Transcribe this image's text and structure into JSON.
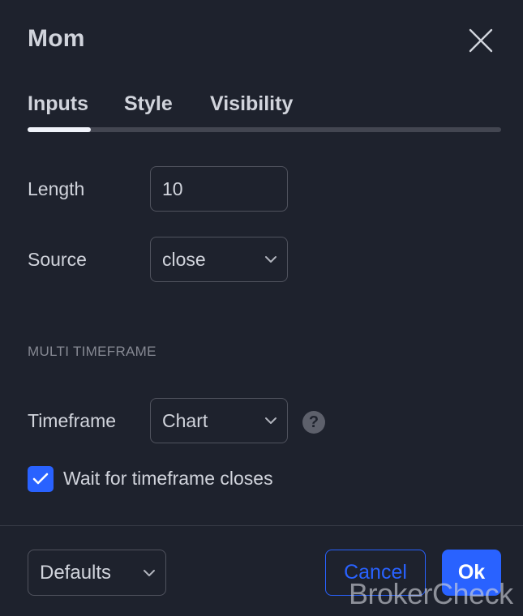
{
  "dialog": {
    "title": "Mom"
  },
  "tabs": [
    {
      "label": "Inputs",
      "active": true
    },
    {
      "label": "Style",
      "active": false
    },
    {
      "label": "Visibility",
      "active": false
    }
  ],
  "inputs": {
    "length_label": "Length",
    "length_value": "10",
    "source_label": "Source",
    "source_value": "close"
  },
  "multi_timeframe": {
    "section_title": "MULTI TIMEFRAME",
    "timeframe_label": "Timeframe",
    "timeframe_value": "Chart",
    "help_icon_glyph": "?",
    "wait_checkbox_checked": true,
    "wait_checkbox_label": "Wait for timeframe closes"
  },
  "footer": {
    "defaults_label": "Defaults",
    "cancel_label": "Cancel",
    "ok_label": "Ok"
  },
  "watermark": "BrokerCheck",
  "colors": {
    "background": "#1e222d",
    "accent": "#2962ff",
    "text": "#d1d4dc",
    "muted": "#868993",
    "border": "#50535e"
  },
  "icons": {
    "close": "close-icon",
    "chevron": "chevron-down-icon",
    "help": "help-icon",
    "check": "checkmark-icon"
  }
}
